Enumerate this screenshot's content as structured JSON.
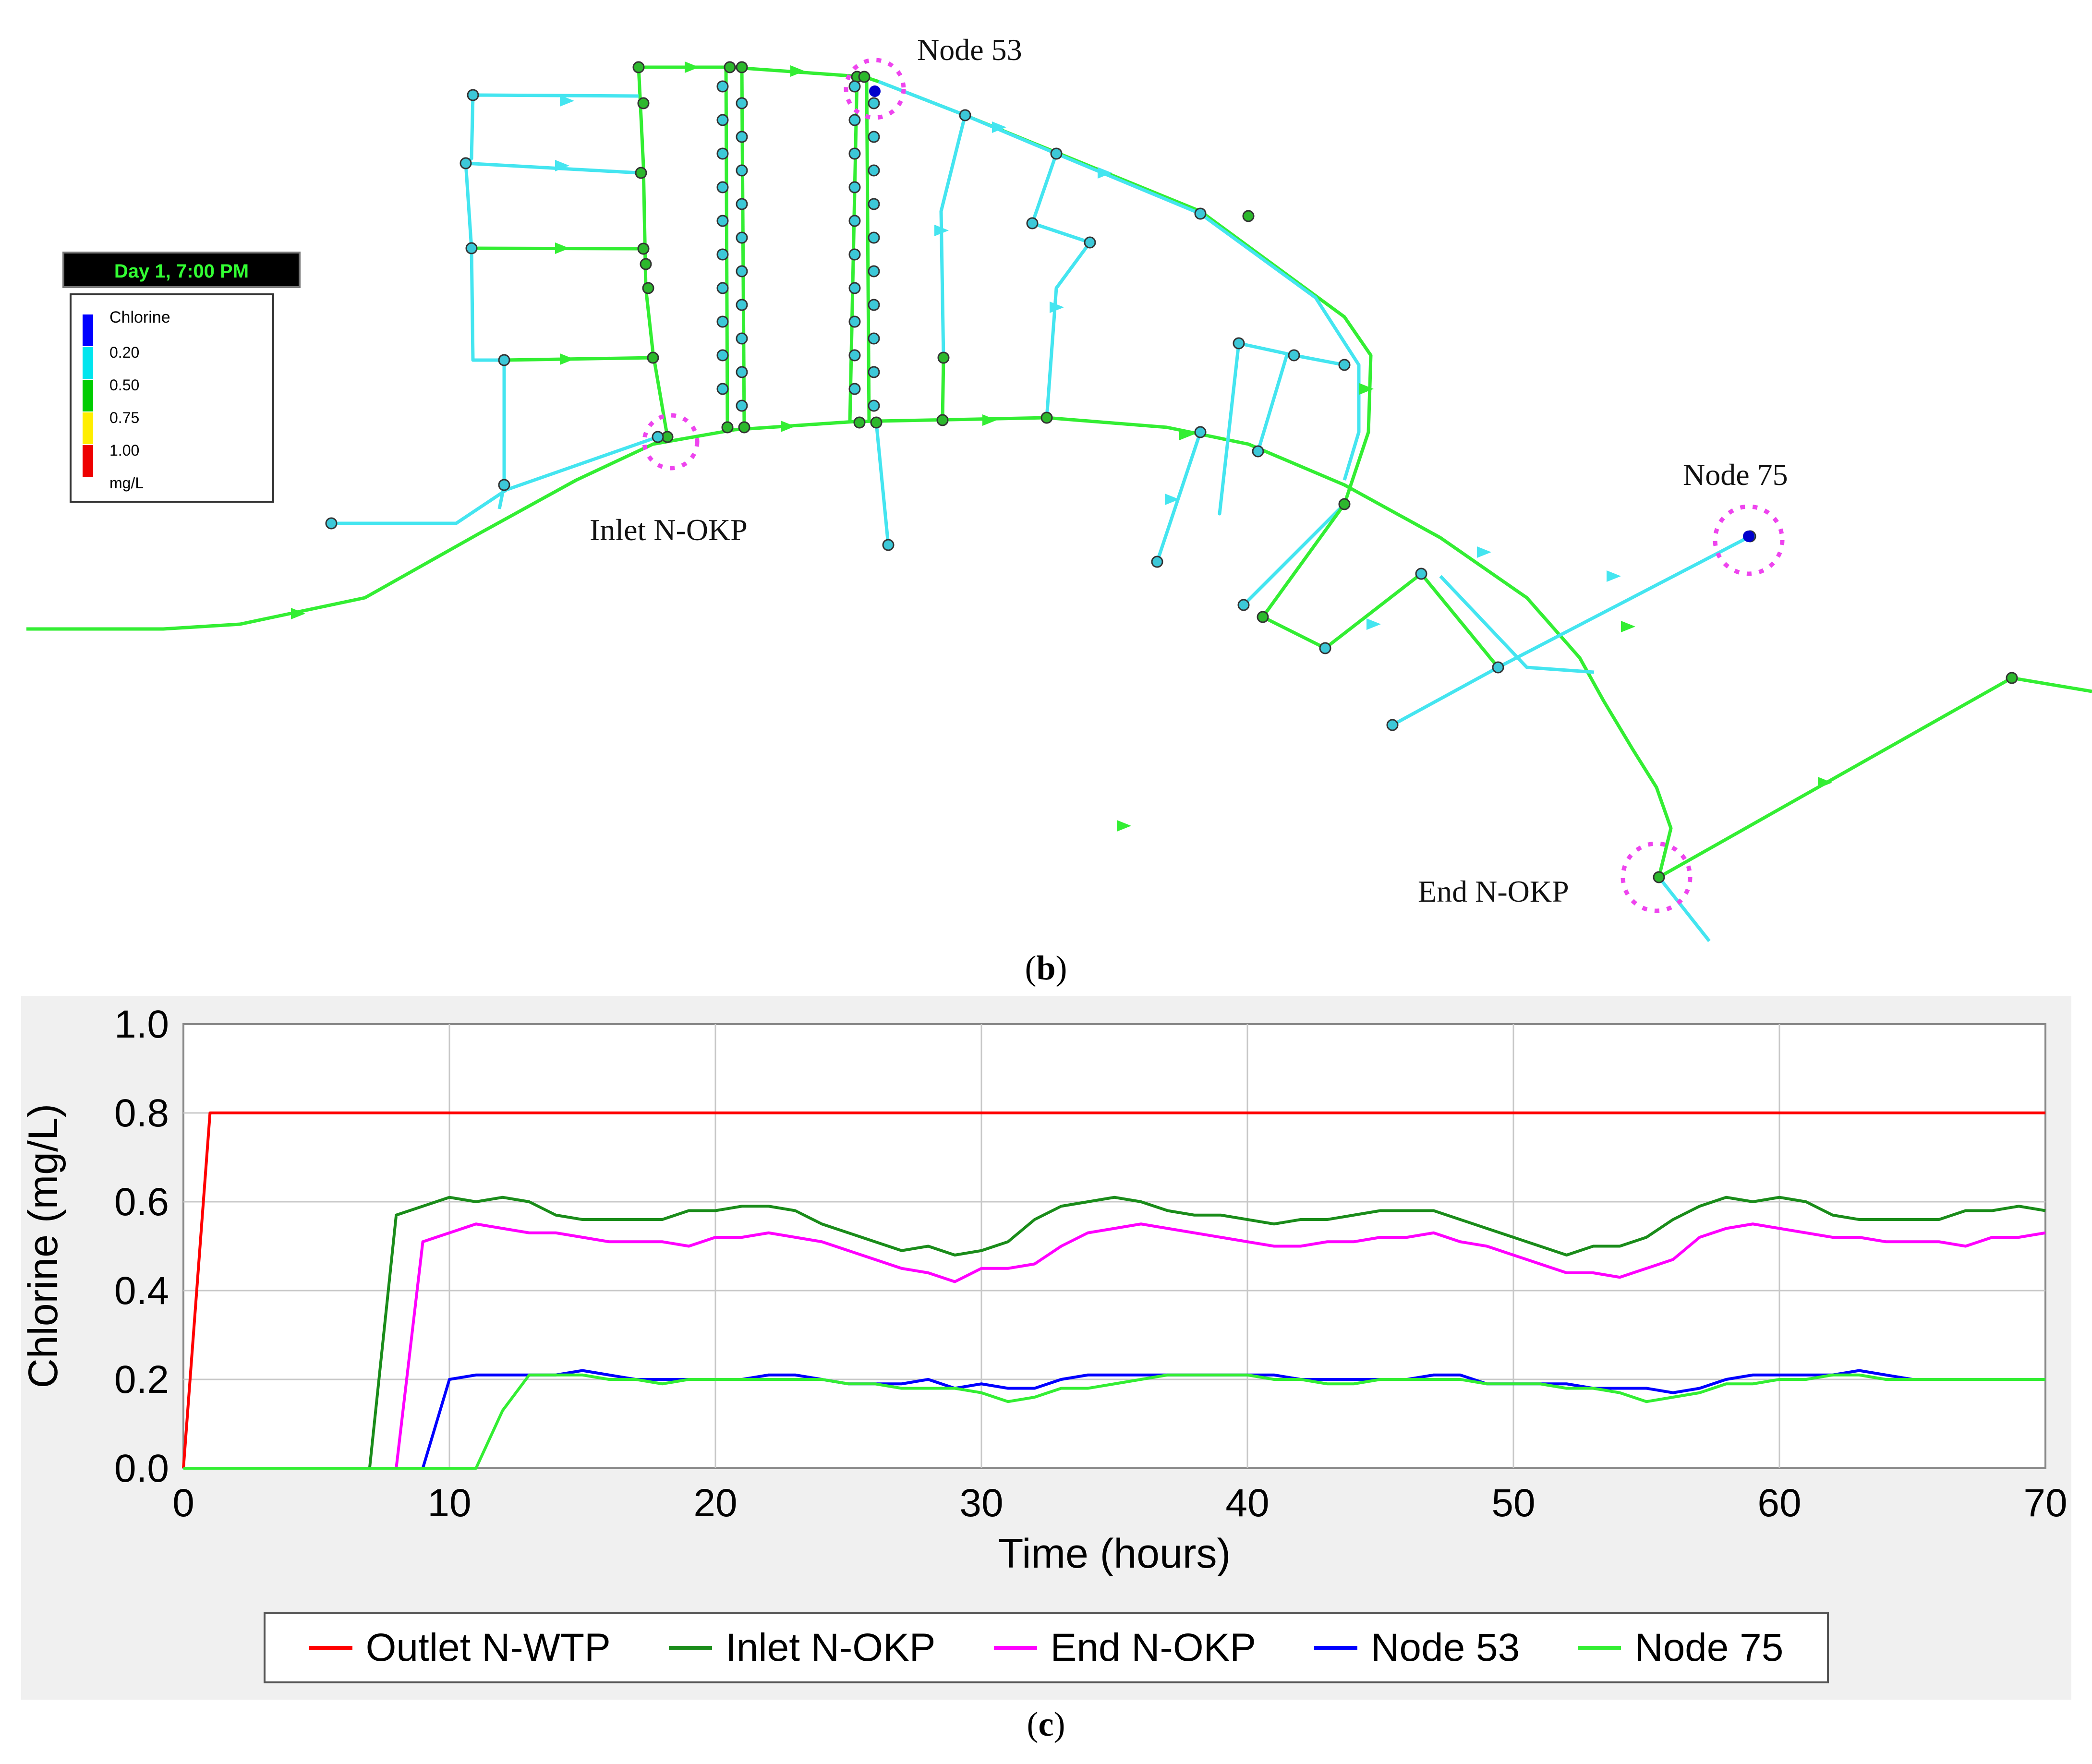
{
  "network": {
    "time_label": "Day 1, 7:00 PM",
    "legend_title": "Chlorine",
    "legend_items": [
      {
        "label": "0.20",
        "color": "#0000ff"
      },
      {
        "label": "0.50",
        "color": "#00e5ee"
      },
      {
        "label": "0.75",
        "color": "#00cc00"
      },
      {
        "label": "1.00",
        "color": "#ffee00"
      },
      {
        "label": "mg/L",
        "color": "#ee0000"
      }
    ],
    "annotations": {
      "node53": "Node 53",
      "node75": "Node 75",
      "inlet": "Inlet N-OKP",
      "end": "End N-OKP"
    },
    "colors": {
      "high": "#33ee33",
      "low": "#44e5f0",
      "node_fill_green": "#2db82d",
      "node_fill_cyan": "#3cc8d8",
      "highlight": "#ee44ee"
    }
  },
  "panel_labels": {
    "b": "b",
    "c": "c"
  },
  "chart_data": {
    "type": "line",
    "xlabel": "Time (hours)",
    "ylabel": "Chlorine (mg/L)",
    "xlim": [
      0,
      70
    ],
    "ylim": [
      0,
      1.0
    ],
    "xticks": [
      "0",
      "10",
      "20",
      "30",
      "40",
      "50",
      "60",
      "70"
    ],
    "yticks": [
      "0.0",
      "0.2",
      "0.4",
      "0.6",
      "0.8",
      "1.0"
    ],
    "grid": true,
    "legend_position": "bottom",
    "series": [
      {
        "name": "Outlet N-WTP",
        "color": "#ff0000",
        "points": [
          [
            0,
            0
          ],
          [
            1,
            0.8
          ],
          [
            70,
            0.8
          ]
        ]
      },
      {
        "name": "Inlet N-OKP",
        "color": "#1a8c1a",
        "points": [
          [
            0,
            0
          ],
          [
            7,
            0
          ],
          [
            8,
            0.57
          ],
          [
            9,
            0.59
          ],
          [
            10,
            0.61
          ],
          [
            11,
            0.6
          ],
          [
            12,
            0.61
          ],
          [
            13,
            0.6
          ],
          [
            14,
            0.57
          ],
          [
            15,
            0.56
          ],
          [
            16,
            0.56
          ],
          [
            17,
            0.56
          ],
          [
            18,
            0.56
          ],
          [
            19,
            0.58
          ],
          [
            20,
            0.58
          ],
          [
            21,
            0.59
          ],
          [
            22,
            0.59
          ],
          [
            23,
            0.58
          ],
          [
            24,
            0.55
          ],
          [
            25,
            0.53
          ],
          [
            26,
            0.51
          ],
          [
            27,
            0.49
          ],
          [
            28,
            0.5
          ],
          [
            29,
            0.48
          ],
          [
            30,
            0.49
          ],
          [
            31,
            0.51
          ],
          [
            32,
            0.56
          ],
          [
            33,
            0.59
          ],
          [
            34,
            0.6
          ],
          [
            35,
            0.61
          ],
          [
            36,
            0.6
          ],
          [
            37,
            0.58
          ],
          [
            38,
            0.57
          ],
          [
            39,
            0.57
          ],
          [
            40,
            0.56
          ],
          [
            41,
            0.55
          ],
          [
            42,
            0.56
          ],
          [
            43,
            0.56
          ],
          [
            44,
            0.57
          ],
          [
            45,
            0.58
          ],
          [
            46,
            0.58
          ],
          [
            47,
            0.58
          ],
          [
            48,
            0.56
          ],
          [
            49,
            0.54
          ],
          [
            50,
            0.52
          ],
          [
            51,
            0.5
          ],
          [
            52,
            0.48
          ],
          [
            53,
            0.5
          ],
          [
            54,
            0.5
          ],
          [
            55,
            0.52
          ],
          [
            56,
            0.56
          ],
          [
            57,
            0.59
          ],
          [
            58,
            0.61
          ],
          [
            59,
            0.6
          ],
          [
            60,
            0.61
          ],
          [
            61,
            0.6
          ],
          [
            62,
            0.57
          ],
          [
            63,
            0.56
          ],
          [
            64,
            0.56
          ],
          [
            65,
            0.56
          ],
          [
            66,
            0.56
          ],
          [
            67,
            0.58
          ],
          [
            68,
            0.58
          ],
          [
            69,
            0.59
          ],
          [
            70,
            0.58
          ]
        ]
      },
      {
        "name": "End N-OKP",
        "color": "#ff00ff",
        "points": [
          [
            0,
            0
          ],
          [
            8,
            0
          ],
          [
            9,
            0.51
          ],
          [
            10,
            0.53
          ],
          [
            11,
            0.55
          ],
          [
            12,
            0.54
          ],
          [
            13,
            0.53
          ],
          [
            14,
            0.53
          ],
          [
            15,
            0.52
          ],
          [
            16,
            0.51
          ],
          [
            17,
            0.51
          ],
          [
            18,
            0.51
          ],
          [
            19,
            0.5
          ],
          [
            20,
            0.52
          ],
          [
            21,
            0.52
          ],
          [
            22,
            0.53
          ],
          [
            23,
            0.52
          ],
          [
            24,
            0.51
          ],
          [
            25,
            0.49
          ],
          [
            26,
            0.47
          ],
          [
            27,
            0.45
          ],
          [
            28,
            0.44
          ],
          [
            29,
            0.42
          ],
          [
            30,
            0.45
          ],
          [
            31,
            0.45
          ],
          [
            32,
            0.46
          ],
          [
            33,
            0.5
          ],
          [
            34,
            0.53
          ],
          [
            35,
            0.54
          ],
          [
            36,
            0.55
          ],
          [
            37,
            0.54
          ],
          [
            38,
            0.53
          ],
          [
            39,
            0.52
          ],
          [
            40,
            0.51
          ],
          [
            41,
            0.5
          ],
          [
            42,
            0.5
          ],
          [
            43,
            0.51
          ],
          [
            44,
            0.51
          ],
          [
            45,
            0.52
          ],
          [
            46,
            0.52
          ],
          [
            47,
            0.53
          ],
          [
            48,
            0.51
          ],
          [
            49,
            0.5
          ],
          [
            50,
            0.48
          ],
          [
            51,
            0.46
          ],
          [
            52,
            0.44
          ],
          [
            53,
            0.44
          ],
          [
            54,
            0.43
          ],
          [
            55,
            0.45
          ],
          [
            56,
            0.47
          ],
          [
            57,
            0.52
          ],
          [
            58,
            0.54
          ],
          [
            59,
            0.55
          ],
          [
            60,
            0.54
          ],
          [
            61,
            0.53
          ],
          [
            62,
            0.52
          ],
          [
            63,
            0.52
          ],
          [
            64,
            0.51
          ],
          [
            65,
            0.51
          ],
          [
            66,
            0.51
          ],
          [
            67,
            0.5
          ],
          [
            68,
            0.52
          ],
          [
            69,
            0.52
          ],
          [
            70,
            0.53
          ]
        ]
      },
      {
        "name": "Node 53",
        "color": "#0000ff",
        "points": [
          [
            0,
            0
          ],
          [
            9,
            0
          ],
          [
            10,
            0.2
          ],
          [
            11,
            0.21
          ],
          [
            12,
            0.21
          ],
          [
            13,
            0.21
          ],
          [
            14,
            0.21
          ],
          [
            15,
            0.22
          ],
          [
            16,
            0.21
          ],
          [
            17,
            0.2
          ],
          [
            18,
            0.2
          ],
          [
            19,
            0.2
          ],
          [
            20,
            0.2
          ],
          [
            21,
            0.2
          ],
          [
            22,
            0.21
          ],
          [
            23,
            0.21
          ],
          [
            24,
            0.2
          ],
          [
            25,
            0.19
          ],
          [
            26,
            0.19
          ],
          [
            27,
            0.19
          ],
          [
            28,
            0.2
          ],
          [
            29,
            0.18
          ],
          [
            30,
            0.19
          ],
          [
            31,
            0.18
          ],
          [
            32,
            0.18
          ],
          [
            33,
            0.2
          ],
          [
            34,
            0.21
          ],
          [
            35,
            0.21
          ],
          [
            36,
            0.21
          ],
          [
            37,
            0.21
          ],
          [
            38,
            0.21
          ],
          [
            39,
            0.21
          ],
          [
            40,
            0.21
          ],
          [
            41,
            0.21
          ],
          [
            42,
            0.2
          ],
          [
            43,
            0.2
          ],
          [
            44,
            0.2
          ],
          [
            45,
            0.2
          ],
          [
            46,
            0.2
          ],
          [
            47,
            0.21
          ],
          [
            48,
            0.21
          ],
          [
            49,
            0.19
          ],
          [
            50,
            0.19
          ],
          [
            51,
            0.19
          ],
          [
            52,
            0.19
          ],
          [
            53,
            0.18
          ],
          [
            54,
            0.18
          ],
          [
            55,
            0.18
          ],
          [
            56,
            0.17
          ],
          [
            57,
            0.18
          ],
          [
            58,
            0.2
          ],
          [
            59,
            0.21
          ],
          [
            60,
            0.21
          ],
          [
            61,
            0.21
          ],
          [
            62,
            0.21
          ],
          [
            63,
            0.22
          ],
          [
            64,
            0.21
          ],
          [
            65,
            0.2
          ],
          [
            66,
            0.2
          ],
          [
            67,
            0.2
          ],
          [
            68,
            0.2
          ],
          [
            69,
            0.2
          ],
          [
            70,
            0.2
          ]
        ]
      },
      {
        "name": "Node 75",
        "color": "#33ee33",
        "points": [
          [
            0,
            0
          ],
          [
            11,
            0
          ],
          [
            12,
            0.13
          ],
          [
            13,
            0.21
          ],
          [
            14,
            0.21
          ],
          [
            15,
            0.21
          ],
          [
            16,
            0.2
          ],
          [
            17,
            0.2
          ],
          [
            18,
            0.19
          ],
          [
            19,
            0.2
          ],
          [
            20,
            0.2
          ],
          [
            21,
            0.2
          ],
          [
            22,
            0.2
          ],
          [
            23,
            0.2
          ],
          [
            24,
            0.2
          ],
          [
            25,
            0.19
          ],
          [
            26,
            0.19
          ],
          [
            27,
            0.18
          ],
          [
            28,
            0.18
          ],
          [
            29,
            0.18
          ],
          [
            30,
            0.17
          ],
          [
            31,
            0.15
          ],
          [
            32,
            0.16
          ],
          [
            33,
            0.18
          ],
          [
            34,
            0.18
          ],
          [
            35,
            0.19
          ],
          [
            36,
            0.2
          ],
          [
            37,
            0.21
          ],
          [
            38,
            0.21
          ],
          [
            39,
            0.21
          ],
          [
            40,
            0.21
          ],
          [
            41,
            0.2
          ],
          [
            42,
            0.2
          ],
          [
            43,
            0.19
          ],
          [
            44,
            0.19
          ],
          [
            45,
            0.2
          ],
          [
            46,
            0.2
          ],
          [
            47,
            0.2
          ],
          [
            48,
            0.2
          ],
          [
            49,
            0.19
          ],
          [
            50,
            0.19
          ],
          [
            51,
            0.19
          ],
          [
            52,
            0.18
          ],
          [
            53,
            0.18
          ],
          [
            54,
            0.17
          ],
          [
            55,
            0.15
          ],
          [
            56,
            0.16
          ],
          [
            57,
            0.17
          ],
          [
            58,
            0.19
          ],
          [
            59,
            0.19
          ],
          [
            60,
            0.2
          ],
          [
            61,
            0.2
          ],
          [
            62,
            0.21
          ],
          [
            63,
            0.21
          ],
          [
            64,
            0.2
          ],
          [
            65,
            0.2
          ],
          [
            66,
            0.2
          ],
          [
            67,
            0.2
          ],
          [
            68,
            0.2
          ],
          [
            69,
            0.2
          ],
          [
            70,
            0.2
          ]
        ]
      }
    ]
  }
}
